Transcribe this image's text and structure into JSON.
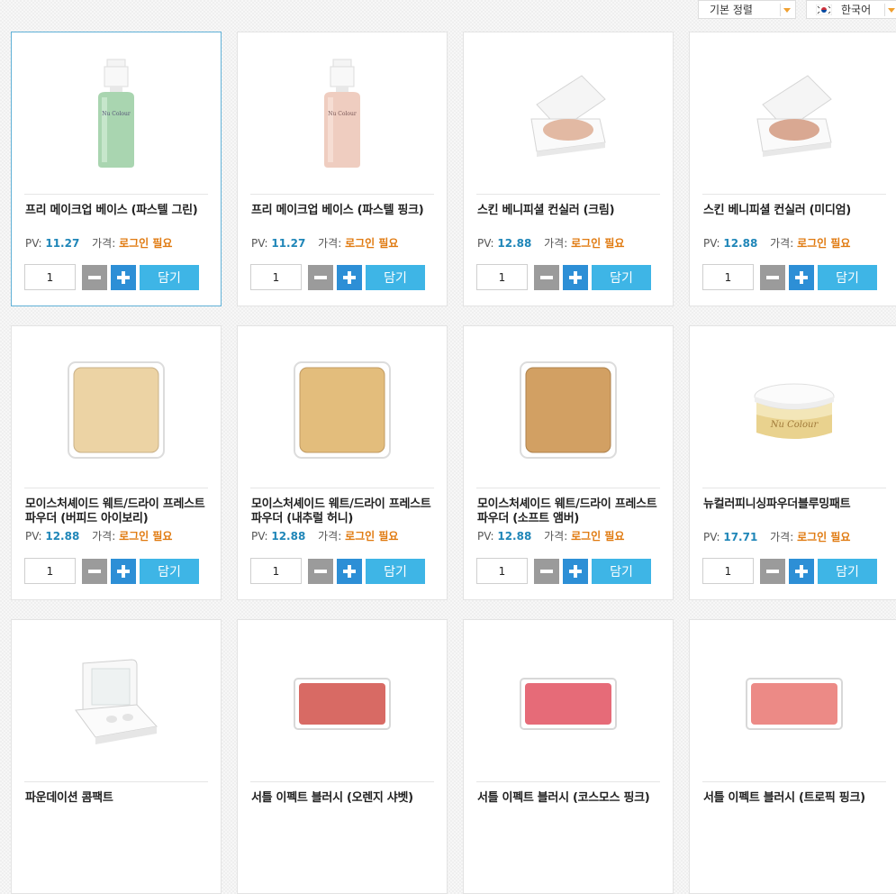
{
  "toolbar": {
    "sort_label": "기본 정렬",
    "language_label": "한국어"
  },
  "labels": {
    "pv": "PV:",
    "price": "가격:",
    "login_required": "로그인 필요",
    "add_button": "담기"
  },
  "colors": {
    "accent": "#3eb5e6",
    "plus": "#2d8fd6",
    "minus": "#9b9b9b",
    "pv_value": "#1f86b8",
    "login_text": "#e07a10"
  },
  "products": [
    {
      "name": "프리 메이크업 베이스 (파스텔 그린)",
      "pv": "11.27",
      "qty": "1",
      "image": "green-base-bottle"
    },
    {
      "name": "프리 메이크업 베이스 (파스텔 핑크)",
      "pv": "11.27",
      "qty": "1",
      "image": "pink-base-bottle"
    },
    {
      "name": "스킨 베니피셜 컨실러 (크림)",
      "pv": "12.88",
      "qty": "1",
      "image": "concealer-compact"
    },
    {
      "name": "스킨 베니피셜 컨실러 (미디엄)",
      "pv": "12.88",
      "qty": "1",
      "image": "concealer-compact"
    },
    {
      "name": "모이스처셰이드 웨트/드라이 프레스트 파우더 (버피드 아이보리)",
      "pv": "12.88",
      "qty": "1",
      "image": "powder-refill-ivory"
    },
    {
      "name": "모이스처셰이드 웨트/드라이 프레스트 파우더 (내추럴 허니)",
      "pv": "12.88",
      "qty": "1",
      "image": "powder-refill-honey"
    },
    {
      "name": "모이스처셰이드 웨트/드라이 프레스트파우더 (소프트 앰버)",
      "pv": "12.88",
      "qty": "1",
      "image": "powder-refill-amber"
    },
    {
      "name": "뉴컬러피니싱파우더블루밍패트",
      "pv": "17.71",
      "qty": "1",
      "image": "loose-powder-jar"
    },
    {
      "name": "파운데이션 콤팩트",
      "image": "foundation-compact"
    },
    {
      "name": "서틀 이펙트 블러시 (오렌지 샤벳)",
      "image": "blush-orange"
    },
    {
      "name": "서틀 이펙트 블러시 (코스모스 핑크)",
      "image": "blush-cosmos-pink"
    },
    {
      "name": "서틀 이펙트 블러시 (트로픽 핑크)",
      "image": "blush-tropic-pink"
    }
  ]
}
